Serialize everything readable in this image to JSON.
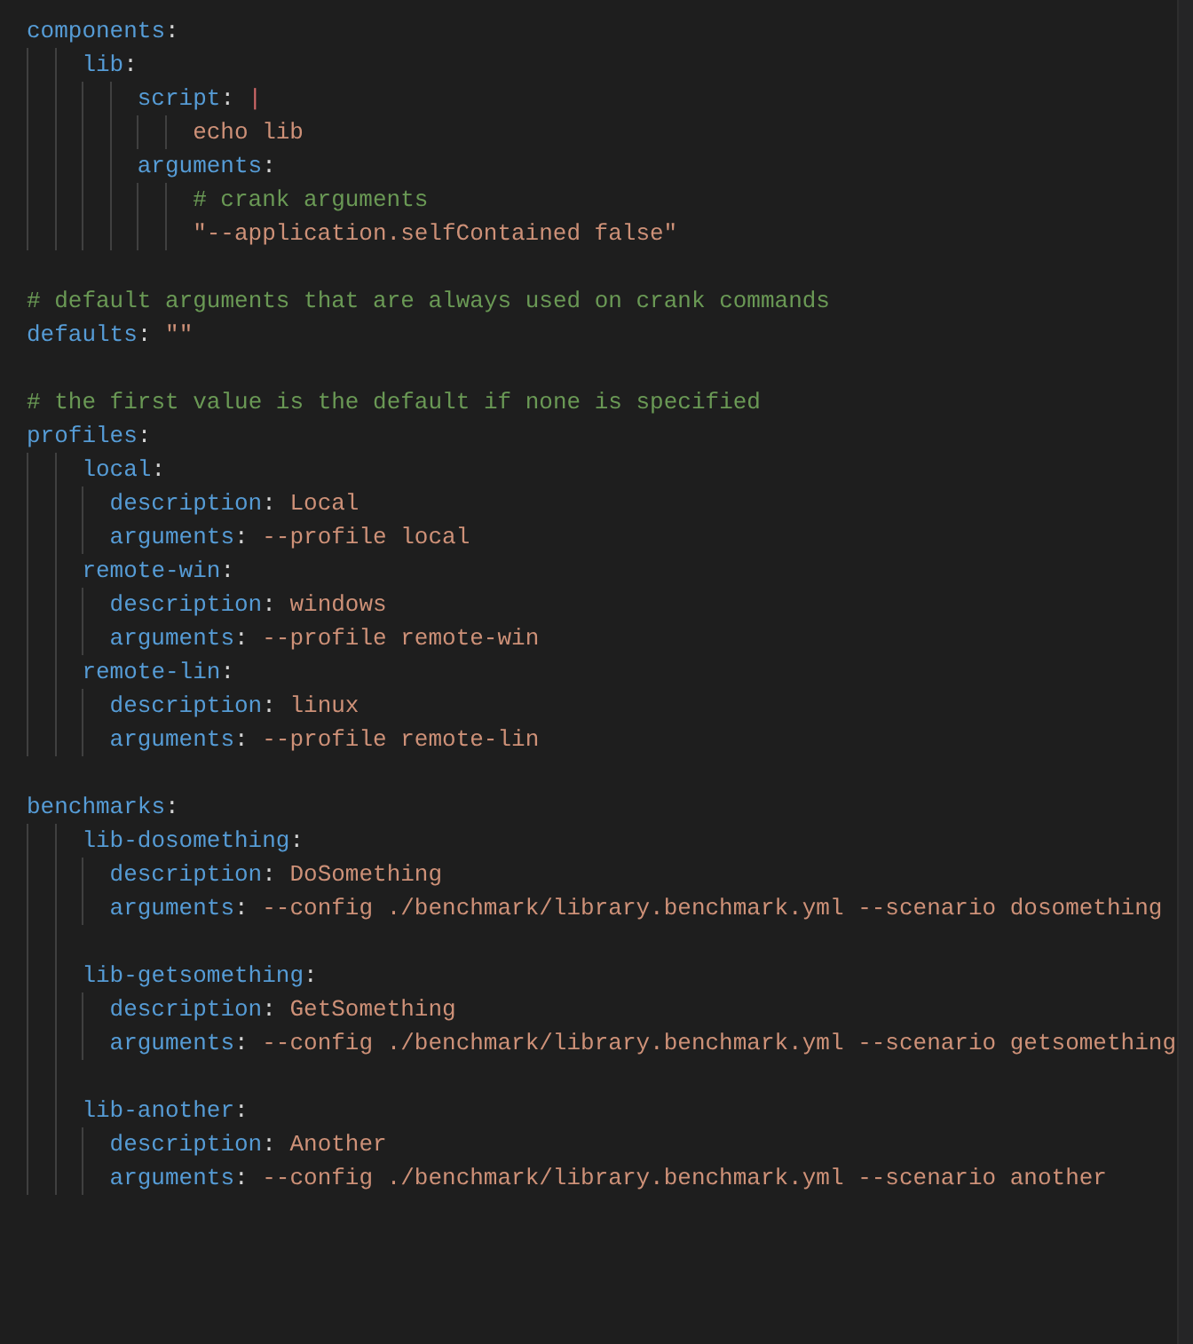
{
  "editor": {
    "lines": [
      {
        "kind": "key",
        "key": "components",
        "punct": ":",
        "wide_indent": true,
        "children": [
          {
            "kind": "key",
            "key": "lib",
            "punct": ":",
            "wide_indent": true,
            "children": [
              {
                "kind": "block",
                "key": "script",
                "punct": ": ",
                "value": "|",
                "wide_indent": true,
                "children": [
                  {
                    "kind": "scalar",
                    "value": "echo lib"
                  }
                ]
              },
              {
                "kind": "key",
                "key": "arguments",
                "punct": ":",
                "wide_indent": true,
                "children": [
                  {
                    "kind": "comment",
                    "text": "# crank arguments"
                  },
                  {
                    "kind": "scalar",
                    "value": "\"--application.selfContained false\""
                  }
                ]
              }
            ]
          }
        ]
      },
      {
        "kind": "blank"
      },
      {
        "kind": "comment",
        "text": "# default arguments that are always used on crank commands"
      },
      {
        "kind": "pair",
        "key": "defaults",
        "punct": ": ",
        "value": "\"\""
      },
      {
        "kind": "blank"
      },
      {
        "kind": "comment",
        "text": "# the first value is the default if none is specified"
      },
      {
        "kind": "key",
        "key": "profiles",
        "punct": ":",
        "wide_indent": true,
        "children": [
          {
            "kind": "key",
            "key": "local",
            "punct": ":",
            "wide_indent": false,
            "children": [
              {
                "kind": "pair",
                "key": "description",
                "punct": ": ",
                "value": "Local"
              },
              {
                "kind": "pair",
                "key": "arguments",
                "punct": ": ",
                "value": "--profile local"
              }
            ]
          },
          {
            "kind": "key",
            "key": "remote-win",
            "punct": ":",
            "wide_indent": false,
            "children": [
              {
                "kind": "pair",
                "key": "description",
                "punct": ": ",
                "value": "windows"
              },
              {
                "kind": "pair",
                "key": "arguments",
                "punct": ": ",
                "value": "--profile remote-win"
              }
            ]
          },
          {
            "kind": "key",
            "key": "remote-lin",
            "punct": ":",
            "wide_indent": false,
            "children": [
              {
                "kind": "pair",
                "key": "description",
                "punct": ": ",
                "value": "linux"
              },
              {
                "kind": "pair",
                "key": "arguments",
                "punct": ": ",
                "value": "--profile remote-lin"
              }
            ]
          }
        ]
      },
      {
        "kind": "blank"
      },
      {
        "kind": "key",
        "key": "benchmarks",
        "punct": ":",
        "wide_indent": true,
        "children": [
          {
            "kind": "key",
            "key": "lib-dosomething",
            "punct": ":",
            "wide_indent": false,
            "children": [
              {
                "kind": "pair",
                "key": "description",
                "punct": ": ",
                "value": "DoSomething"
              },
              {
                "kind": "pair",
                "key": "arguments",
                "punct": ": ",
                "value": "--config ./benchmark/library.benchmark.yml --scenario dosomething"
              }
            ]
          },
          {
            "kind": "blank"
          },
          {
            "kind": "key",
            "key": "lib-getsomething",
            "punct": ":",
            "wide_indent": false,
            "children": [
              {
                "kind": "pair",
                "key": "description",
                "punct": ": ",
                "value": "GetSomething"
              },
              {
                "kind": "pair",
                "key": "arguments",
                "punct": ": ",
                "value": "--config ./benchmark/library.benchmark.yml --scenario getsomething"
              }
            ]
          },
          {
            "kind": "blank"
          },
          {
            "kind": "key",
            "key": "lib-another",
            "punct": ":",
            "wide_indent": false,
            "children": [
              {
                "kind": "pair",
                "key": "description",
                "punct": ": ",
                "value": "Another"
              },
              {
                "kind": "pair",
                "key": "arguments",
                "punct": ": ",
                "value": "--config ./benchmark/library.benchmark.yml --scenario another"
              }
            ]
          }
        ]
      }
    ]
  }
}
